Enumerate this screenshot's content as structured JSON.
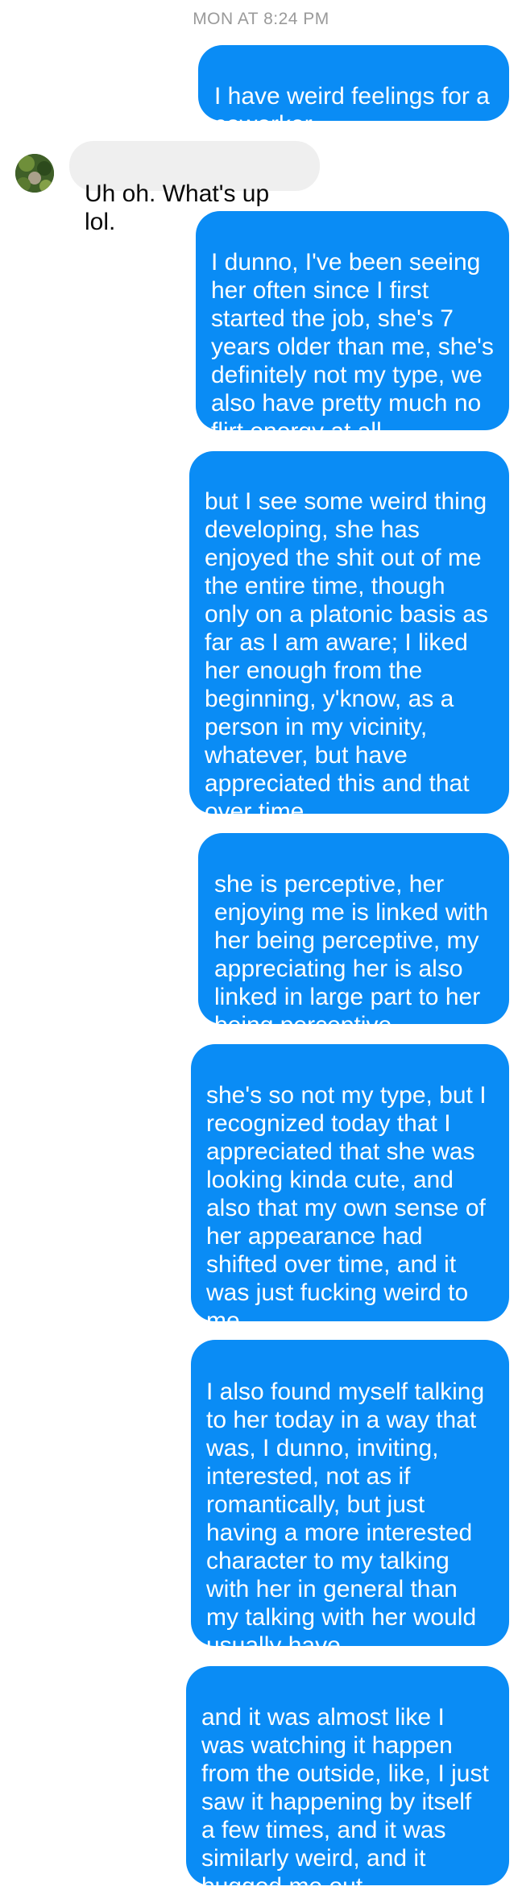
{
  "conversation": {
    "timestamp": "MON AT 8:24 PM",
    "messages": [
      {
        "from": "me",
        "text": "I have weird feelings for a\ncoworker"
      },
      {
        "from": "them",
        "text": "Uh oh. What's up lol."
      },
      {
        "from": "me",
        "text": "I dunno, I've been seeing\nher often since I first\nstarted the job, she's 7\nyears older than me, she's\ndefinitely not my type, we\nalso have pretty much no\nflirt energy at all"
      },
      {
        "from": "me",
        "text": "but I see some weird thing\ndeveloping, she has\nenjoyed the shit out of me\nthe entire time, though\nonly on a platonic basis as\nfar as I am aware; I liked\nher enough from the\nbeginning, y'know, as a\nperson in my vicinity,\nwhatever, but have\nappreciated this and that\nover time"
      },
      {
        "from": "me",
        "text": "she is perceptive, her\nenjoying me is linked with\nher being perceptive, my\nappreciating her is also\nlinked in large part to her\nbeing perceptive"
      },
      {
        "from": "me",
        "text": "she's so not my type, but I\nrecognized today that I\nappreciated that she was\nlooking kinda cute, and\nalso that my own sense of\nher appearance had\nshifted over time, and it\nwas just fucking weird to\nme"
      },
      {
        "from": "me",
        "text": "I also found myself talking\nto her today in a way that\nwas, I dunno, inviting,\ninterested, not as if\nromantically, but just\nhaving a more interested\ncharacter to my talking\nwith her in general than\nmy talking with her would\nusually have"
      },
      {
        "from": "me",
        "text": "and it was almost like I\nwas watching it happen\nfrom the outside, like, I just\nsaw it happening by itself\na few times, and it was\nsimilarly weird, and it\nbugged me out"
      }
    ]
  }
}
